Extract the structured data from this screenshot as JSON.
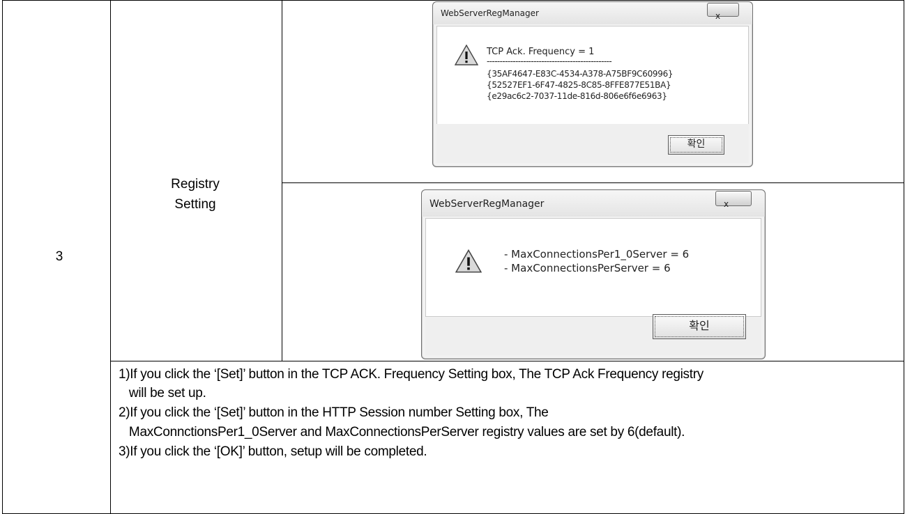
{
  "step_number": "3",
  "category": {
    "line1": "Registry",
    "line2": "Setting"
  },
  "dialog1": {
    "title": "WebServerRegManager",
    "close_glyph": "x",
    "icon": "warning-icon",
    "message_line1": "TCP Ack. Frequency = 1",
    "separator": "------------------------------------------------",
    "guids": [
      "{35AF4647-E83C-4534-A378-A75BF9C60996}",
      "{52527EF1-6F47-4825-8C85-8FFE877E51BA}",
      "{e29ac6c2-7037-11de-816d-806e6f6e6963}"
    ],
    "ok_label": "확인"
  },
  "dialog2": {
    "title": "WebServerRegManager",
    "close_glyph": "x",
    "icon": "warning-icon",
    "lines": [
      "- MaxConnectionsPer1_0Server = 6",
      "- MaxConnectionsPerServer = 6"
    ],
    "ok_label": "확인"
  },
  "description": [
    "1)If you click the ‘[Set]’ button in the TCP ACK. Frequency Setting box, The TCP Ack Frequency registry",
    "   will be set up.",
    "2)If you click the ‘[Set]’ button in the HTTP Session number Setting box, The",
    "   MaxConnctionsPer1_0Server and MaxConnectionsPerServer registry values are set by 6(default).",
    "3)If you click the ‘[OK]’ button, setup will be completed."
  ]
}
